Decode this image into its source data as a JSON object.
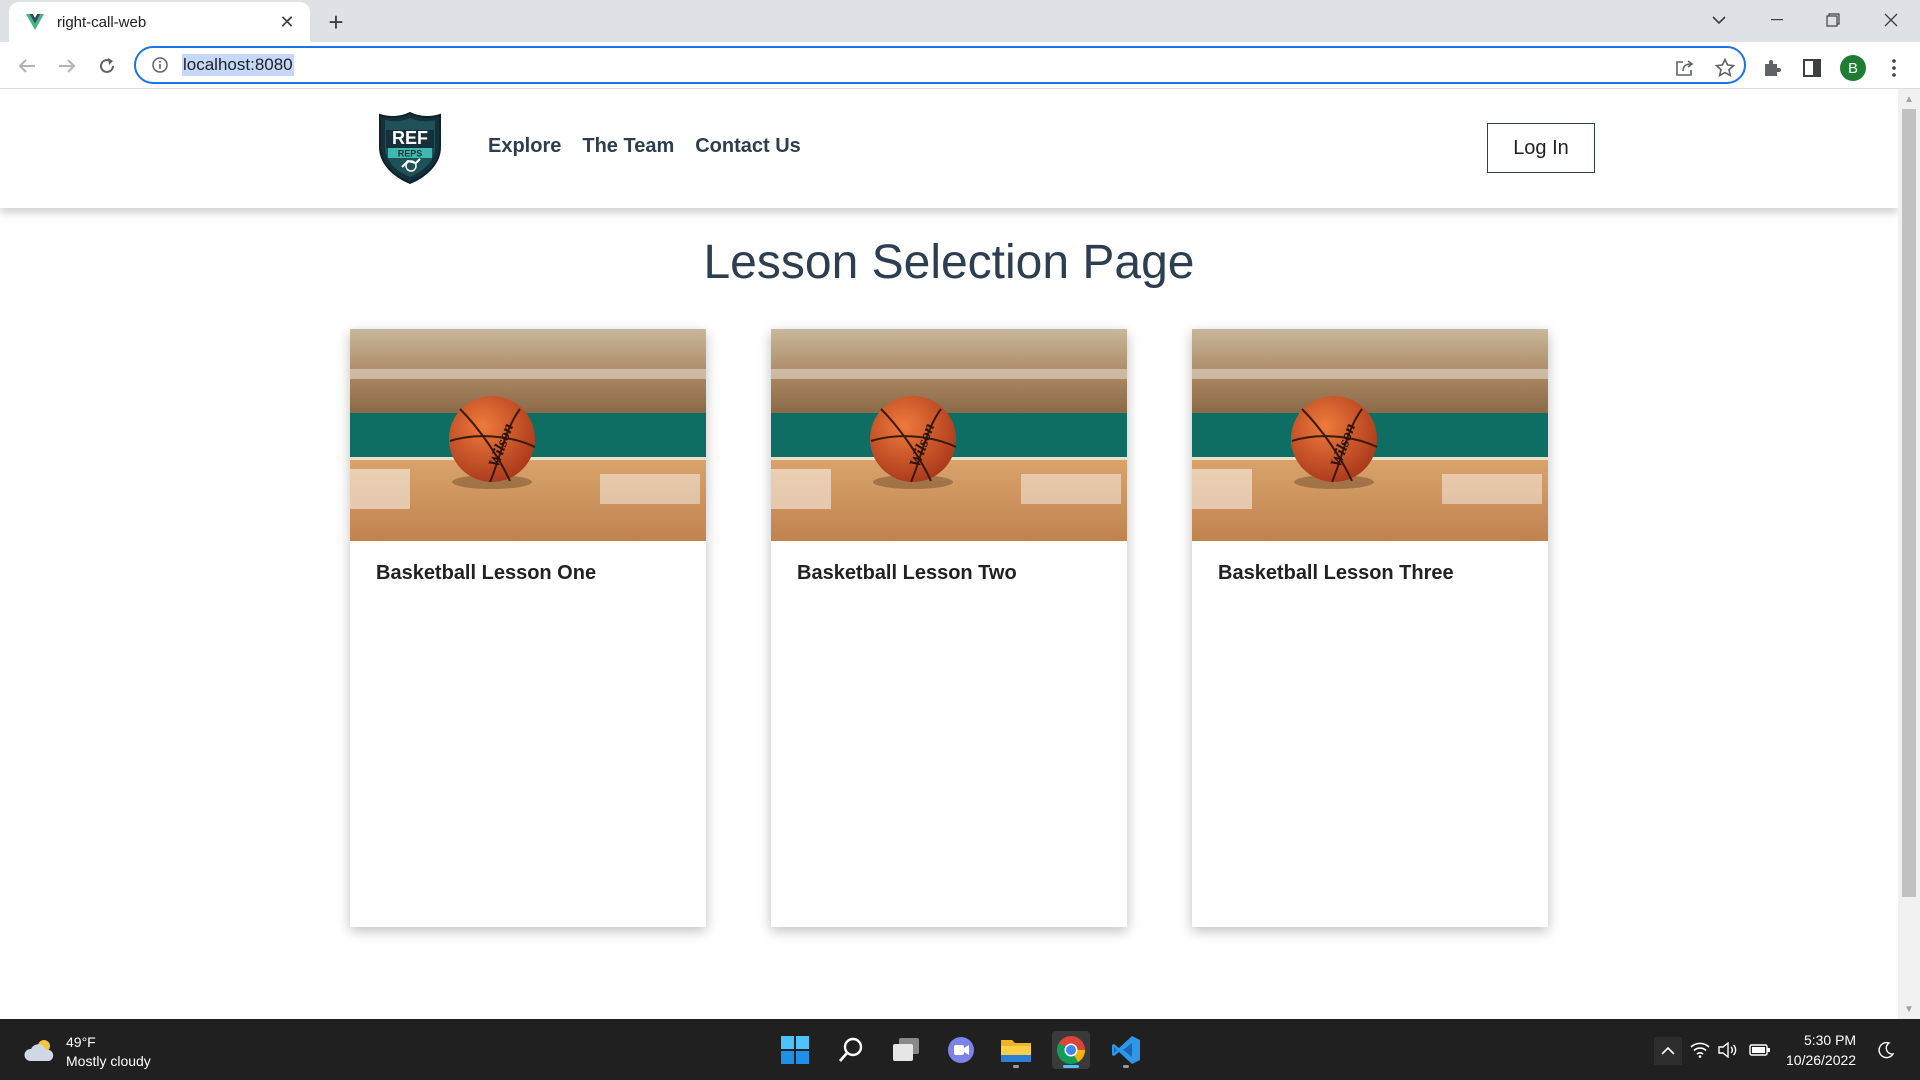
{
  "browser": {
    "tab_title": "right-call-web",
    "url": "localhost:8080",
    "profile_initial": "B"
  },
  "site": {
    "logo_text_top": "REF",
    "logo_text_bottom": "REPS",
    "nav": [
      "Explore",
      "The Team",
      "Contact Us"
    ],
    "login_label": "Log In"
  },
  "page": {
    "title": "Lesson Selection Page",
    "lessons": [
      {
        "title": "Basketball Lesson One",
        "ball_brand": "Wilson"
      },
      {
        "title": "Basketball Lesson Two",
        "ball_brand": "Wilson"
      },
      {
        "title": "Basketball Lesson Three",
        "ball_brand": "Wilson"
      }
    ]
  },
  "taskbar": {
    "weather_temp": "49°F",
    "weather_desc": "Mostly cloudy",
    "time": "5:30 PM",
    "date": "10/26/2022"
  },
  "colors": {
    "accent": "#1a73e8",
    "heading": "#2c3e50",
    "vue_green": "#41b883",
    "court_teal": "#0f6e63",
    "ball_orange": "#d4541f"
  }
}
